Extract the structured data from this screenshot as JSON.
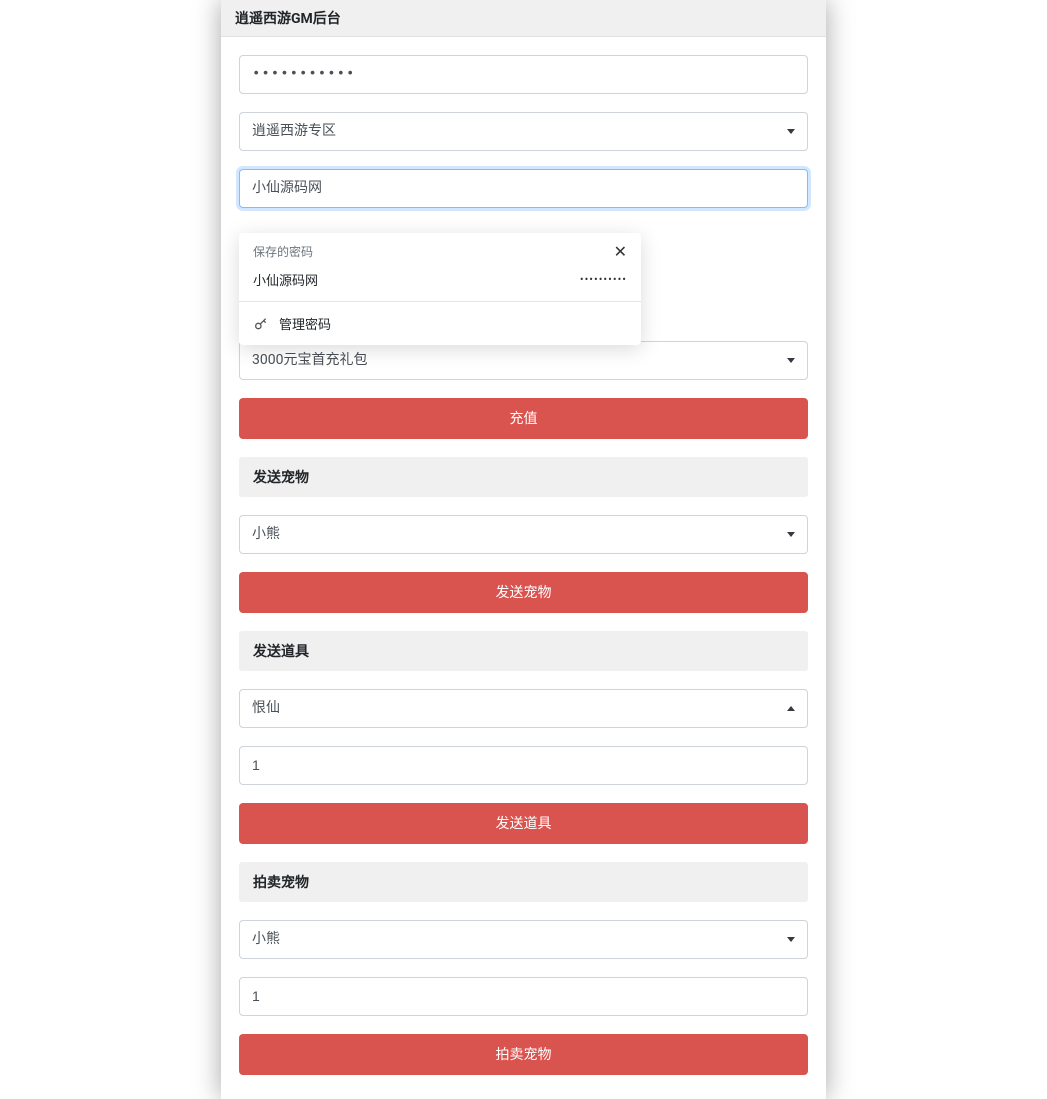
{
  "header": {
    "title": "逍遥西游GM后台"
  },
  "login": {
    "password_value": "•••••••••••",
    "server_select": "逍遥西游专区",
    "username_value": "小仙源码网"
  },
  "password_popup": {
    "title": "保存的密码",
    "saved_username": "小仙源码网",
    "saved_password": "••••••••••",
    "manage_label": "管理密码"
  },
  "recharge": {
    "select_value": "3000元宝首充礼包",
    "button_label": "充值"
  },
  "send_pet": {
    "section_title": "发送宠物",
    "select_value": "小熊",
    "button_label": "发送宠物"
  },
  "send_item": {
    "section_title": "发送道具",
    "select_value": "恨仙",
    "quantity": "1",
    "button_label": "发送道具"
  },
  "auction_pet": {
    "section_title": "拍卖宠物",
    "select_value": "小熊",
    "quantity": "1",
    "button_label": "拍卖宠物"
  }
}
